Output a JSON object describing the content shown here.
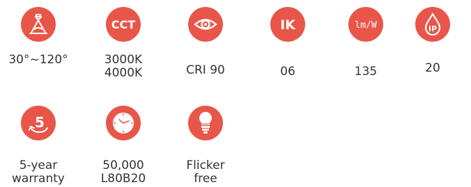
{
  "accent_color": "#e8564a",
  "features": [
    {
      "icon": "beam-angle-icon",
      "label": "30°~120°"
    },
    {
      "icon": "cct-icon",
      "icon_text": "CCT",
      "label_line1": "3000K",
      "label_line2": "4000K"
    },
    {
      "icon": "eye-icon",
      "label": "CRI 90"
    },
    {
      "icon": "ik-icon",
      "icon_text": "IK",
      "label": "06"
    },
    {
      "icon": "lumen-per-watt-icon",
      "icon_text": "lm/W",
      "label": "135"
    },
    {
      "icon": "ip-drop-icon",
      "icon_text": "IP",
      "label": "20"
    },
    {
      "icon": "warranty-icon",
      "icon_text": "5",
      "label_line1": "5-year",
      "label_line2": "warranty"
    },
    {
      "icon": "clock-icon",
      "label_line1": "50,000",
      "label_line2": "L80B20"
    },
    {
      "icon": "bulb-icon",
      "label_line1": "Flicker",
      "label_line2": "free"
    }
  ]
}
